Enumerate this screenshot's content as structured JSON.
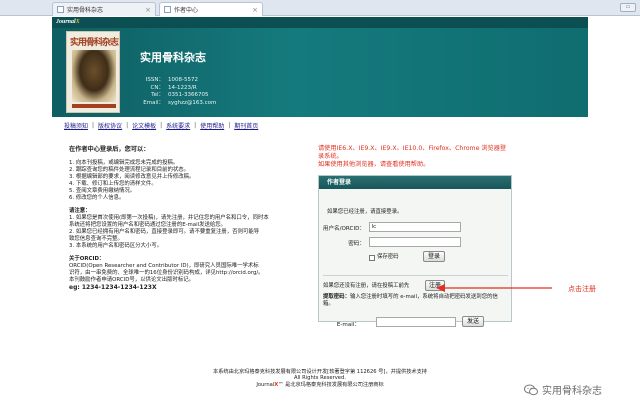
{
  "browser": {
    "tabs": [
      {
        "label": "实用骨科杂志"
      },
      {
        "label": "作者中心"
      }
    ]
  },
  "header": {
    "journal_label_prefix": "Journal",
    "journal_label_suffix": "X",
    "cover_title": "实用骨科杂志",
    "title": "实用骨科杂志",
    "info": [
      {
        "k": "ISSN：",
        "v": "1008-5572"
      },
      {
        "k": "CN：",
        "v": "14-1223/R"
      },
      {
        "k": "Tel：",
        "v": "0351-3366705"
      },
      {
        "k": "Email：",
        "v": "syghzz@163.com"
      }
    ]
  },
  "nav": {
    "items": [
      "投稿须知",
      "版权协议",
      "论文模板",
      "系统要求",
      "使用帮助",
      "期刊首页"
    ],
    "separator": "|"
  },
  "left": {
    "heading": "在作者中心登录后，您可以：",
    "features": [
      "1. 向本刊投稿，或编辑完成您未完成的投稿。",
      "2. 跟踪查询您的稿件处理流程记录和目前的状态。",
      "3. 根据编辑部的要求，阅读修改意见并上传修改稿。",
      "4. 下载、修订和上传您的清样文件。",
      "5. 查阅文章费用缴纳情况。",
      "6. 修改您的个人信息。"
    ],
    "notice_heading": "请注意：",
    "notices": [
      "1. 如果您是首次使用(即第一次投稿)，请先注册，并记住您的用户名和口令，同时本",
      "系统还将把您设置的用户名和密码通过您注册的E-mail发送给您。",
      "2. 如果您已经拥有用户名和密码，直接登录即可。请不要重复注册，否则可能导",
      "致您信息查询不完整。",
      "3. 本系统的用户名和密码区分大小写。"
    ],
    "orcid_heading": "关于ORCID：",
    "orcid_lines": [
      "ORCID(Open Researcher and Contributor ID)，即研究人员国际唯一学术标",
      "识符，由一串免费的、全球唯一的16位身份识别码构成，详见http://orcid.org/。",
      "本刊鼓励作者申请ORCID号，以供论文出版时标记。"
    ],
    "orcid_example": "eg: 1234-1234-1234-123X"
  },
  "warning": {
    "line1": "请使用IE6.X、IE9.X、IE9.X、IE10.0、Firefox、Chrome 浏览器登",
    "line2": "录系统。",
    "line3": "如果使用其他浏览器，请查看使用帮助。"
  },
  "login": {
    "title": "作者登录",
    "note": "如果您已经注册，请直接登录。",
    "username_label": "用户名/ORCID：",
    "username_value": "lc",
    "password_label": "密码：",
    "password_value": "",
    "remember_label": "保存密码",
    "login_button": "登录",
    "register_prompt": "如果您还没有注册，请在投稿工前先",
    "register_button": "注册",
    "forgot_bold": "提取密码：",
    "forgot_text": "输入您注册时填写的 e-mail，系统将自动把密码发送到您的信",
    "forgot_text2": "箱。",
    "email_label": "E-mail：",
    "email_value": "",
    "send_button": "发送"
  },
  "annotation": {
    "text": "点击注册",
    "color": "#e03020"
  },
  "footer": {
    "line1": "本系统由北京玛格泰克科技发展有限公司设计开发[软著登字第 112626 号]，并提供技术支持",
    "line2": "All Rights Reserved.",
    "line3_prefix": "Journal",
    "line3_x": "X",
    "line3_suffix": "™ 是北京玛格泰克科技发展有限公司注册商标"
  },
  "watermark": {
    "icon": "wechat-icon",
    "text": "实用骨科杂志"
  }
}
